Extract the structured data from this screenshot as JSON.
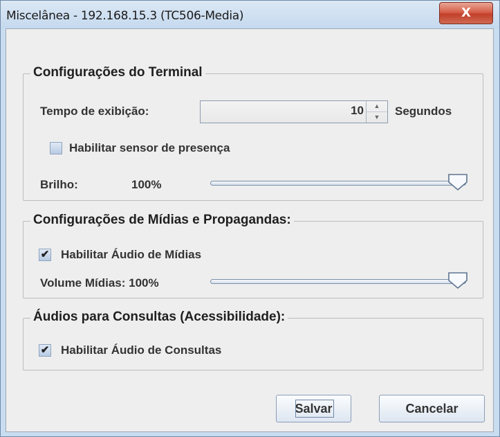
{
  "window": {
    "title": "Miscelânea - 192.168.15.3 (TC506-Media)",
    "close_label": "X"
  },
  "terminal": {
    "legend": "Configurações do Terminal",
    "display_time_label": "Tempo de exibição:",
    "display_time_value": "10",
    "display_time_unit": "Segundos",
    "presence_sensor_label": "Habilitar sensor de presença",
    "presence_sensor_checked": false,
    "brightness_label": "Brilho:",
    "brightness_value": "100%",
    "brightness_level": 1.0
  },
  "media": {
    "legend": "Configurações de Mídias e Propagandas:",
    "audio_label": "Habilitar Áudio de Mídias",
    "audio_checked": true,
    "volume_label": "Volume Mídias: 100%",
    "volume_level": 1.0
  },
  "accessibility": {
    "legend": "Áudios para Consultas (Acessibilidade):",
    "audio_label": "Habilitar Áudio de Consultas",
    "audio_checked": true
  },
  "actions": {
    "save_label": "Salvar",
    "cancel_label": "Cancelar"
  },
  "colors": {
    "title_bar": "#c9ddf0",
    "close_button": "#c2402a",
    "panel_background": "#eeeeee"
  }
}
